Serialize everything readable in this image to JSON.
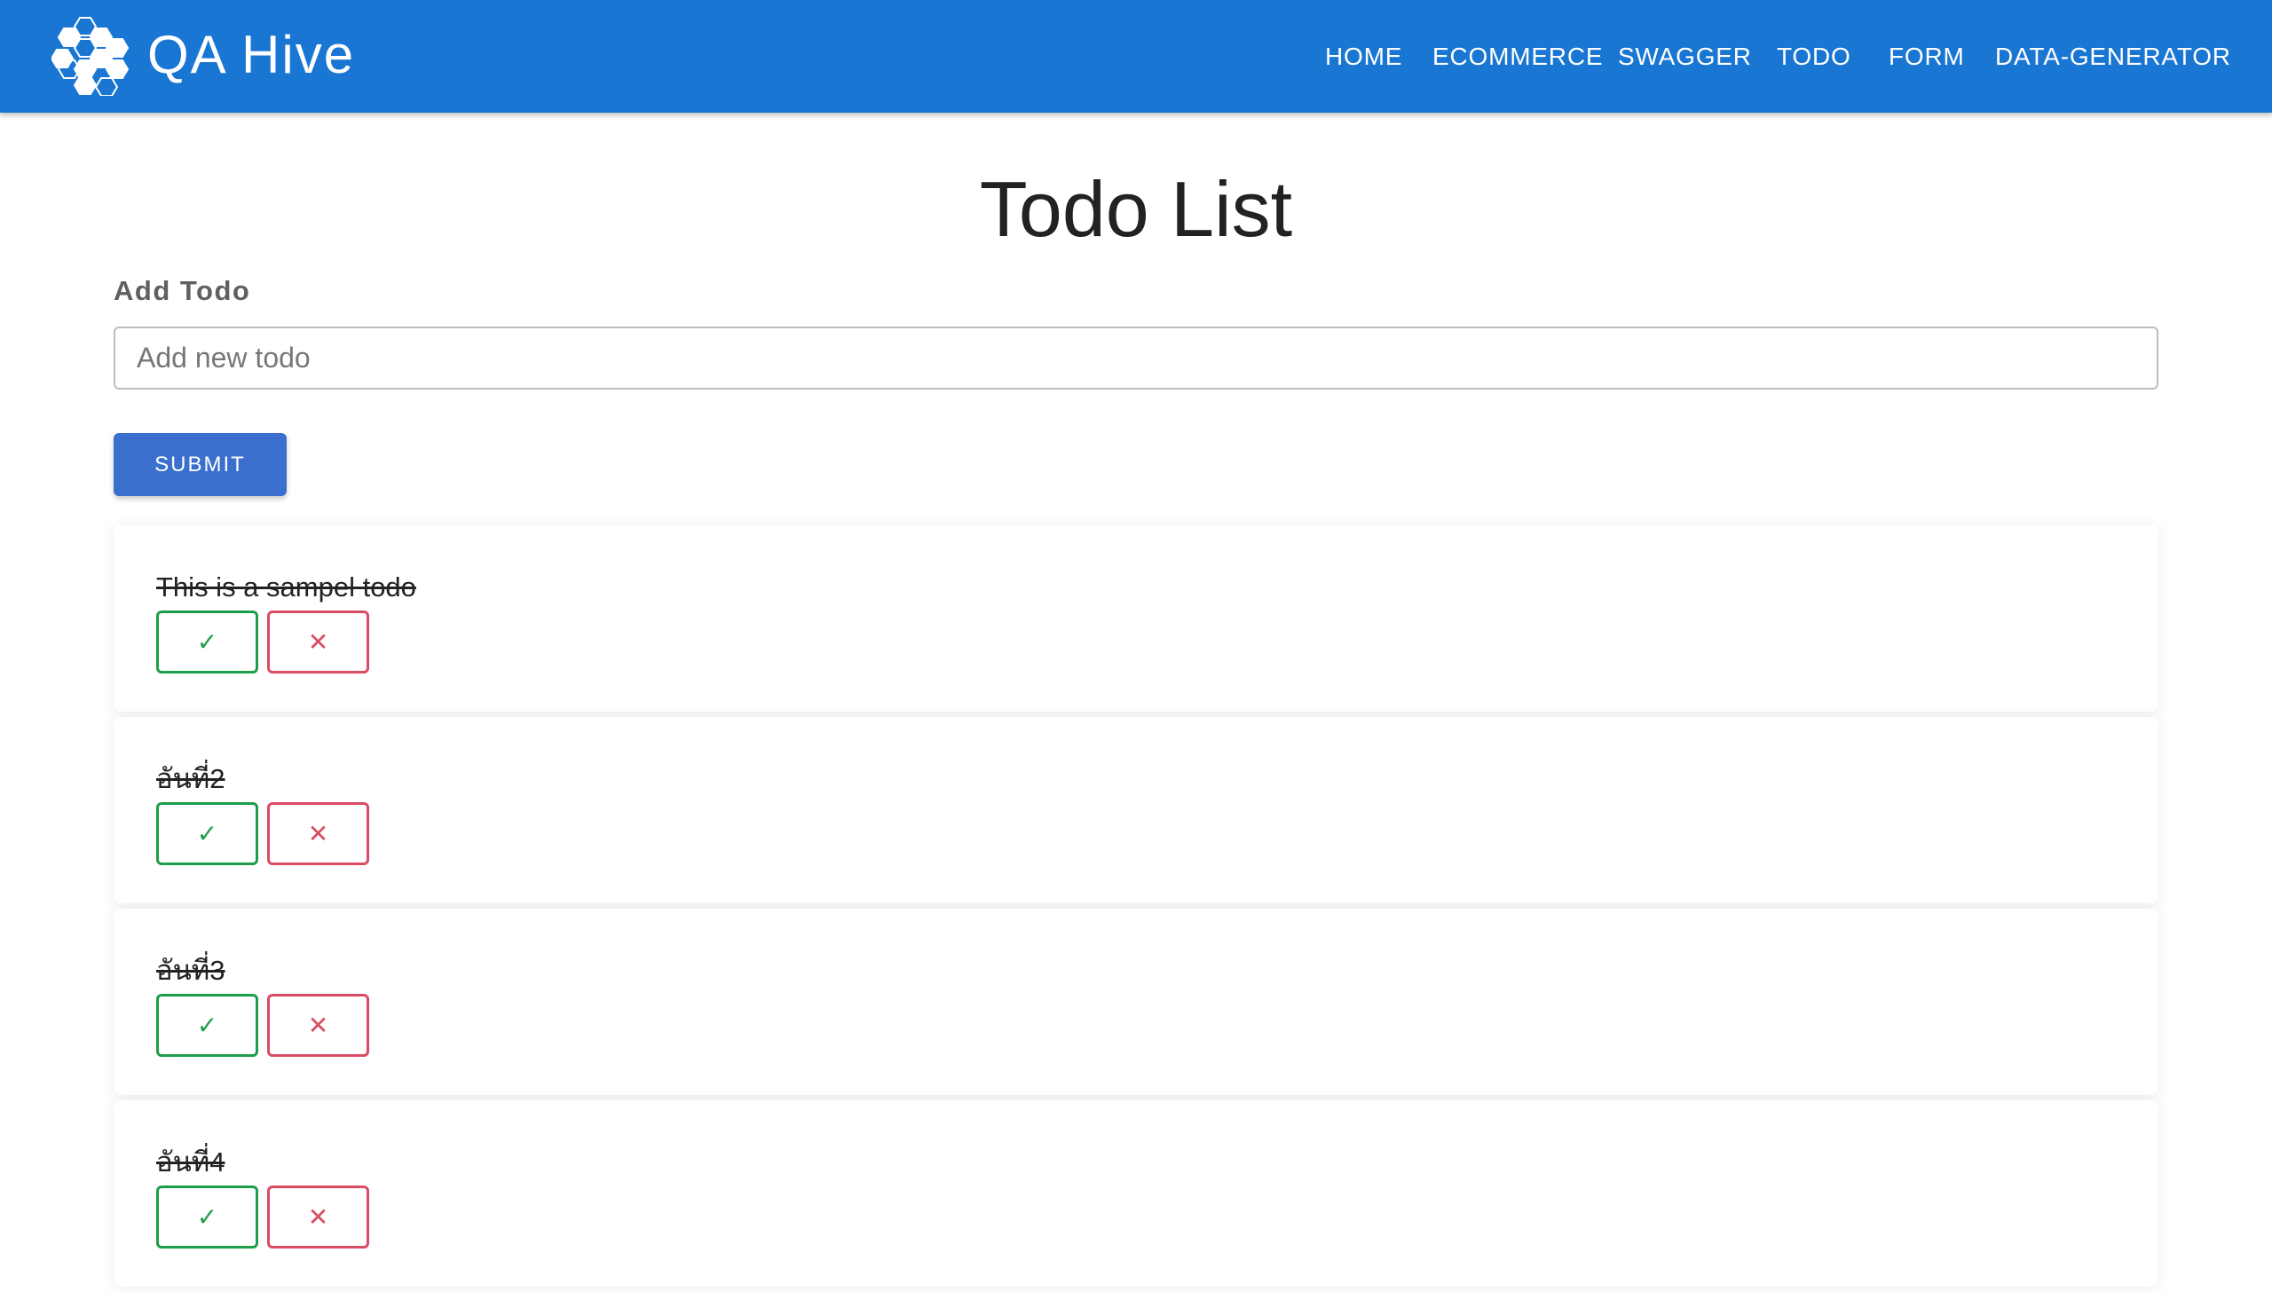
{
  "app": {
    "brand": "QA Hive",
    "nav": [
      "HOME",
      "ECOMMERCE",
      "SWAGGER",
      "TODO",
      "FORM",
      "DATA-GENERATOR"
    ]
  },
  "colors": {
    "appbar": "#1976d2",
    "submit": "#3b6fce",
    "done": "#1e9e4a",
    "delete": "#d94c64"
  },
  "page": {
    "title": "Todo List",
    "add_label": "Add Todo",
    "input_placeholder": "Add new todo",
    "input_value": "",
    "submit_label": "SUBMIT"
  },
  "todos": [
    {
      "text": "This is a sampel todo",
      "done_icon": "✓",
      "delete_icon": "✕"
    },
    {
      "text": "อันที่2",
      "done_icon": "✓",
      "delete_icon": "✕"
    },
    {
      "text": "อันที่3",
      "done_icon": "✓",
      "delete_icon": "✕"
    },
    {
      "text": "อันที่4",
      "done_icon": "✓",
      "delete_icon": "✕"
    }
  ]
}
